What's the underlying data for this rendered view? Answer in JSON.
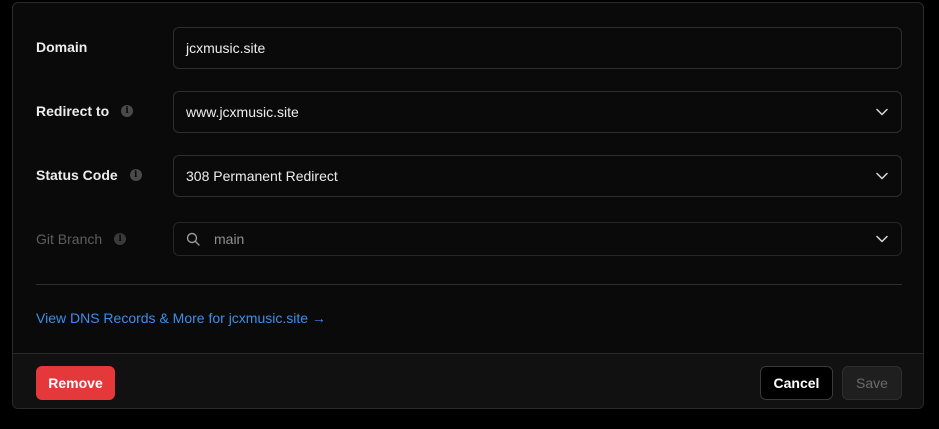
{
  "form": {
    "domain": {
      "label": "Domain",
      "value": "jcxmusic.site"
    },
    "redirect": {
      "label": "Redirect to",
      "value": "www.jcxmusic.site",
      "info_icon": "info-icon"
    },
    "status_code": {
      "label": "Status Code",
      "value": "308 Permanent Redirect",
      "info_icon": "info-icon"
    },
    "git_branch": {
      "label": "Git Branch",
      "value": "main",
      "info_icon": "info-icon",
      "leading_icon": "search-icon"
    }
  },
  "dns_link": {
    "text": "View DNS Records & More for jcxmusic.site →"
  },
  "footer": {
    "remove_label": "Remove",
    "cancel_label": "Cancel",
    "save_label": "Save"
  },
  "colors": {
    "background": "#0a0a0a",
    "link": "#3b8eea",
    "danger": "#e5383b"
  }
}
